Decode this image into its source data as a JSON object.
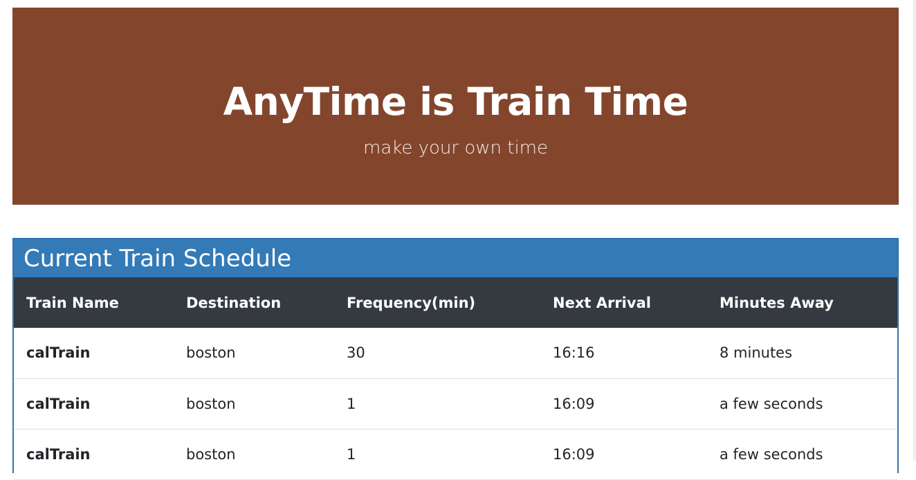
{
  "header": {
    "title": "AnyTime is Train Time",
    "subtitle": "make your own time",
    "background_color": "#83462d"
  },
  "schedule": {
    "title": "Current Train Schedule",
    "accent_color": "#337ab7",
    "columns": [
      "Train Name",
      "Destination",
      "Frequency(min)",
      "Next Arrival",
      "Minutes Away"
    ],
    "rows": [
      [
        "calTrain",
        "boston",
        "30",
        "16:16",
        "8 minutes"
      ],
      [
        "calTrain",
        "boston",
        "1",
        "16:09",
        "a few seconds"
      ],
      [
        "calTrain",
        "boston",
        "1",
        "16:09",
        "a few seconds"
      ]
    ]
  }
}
